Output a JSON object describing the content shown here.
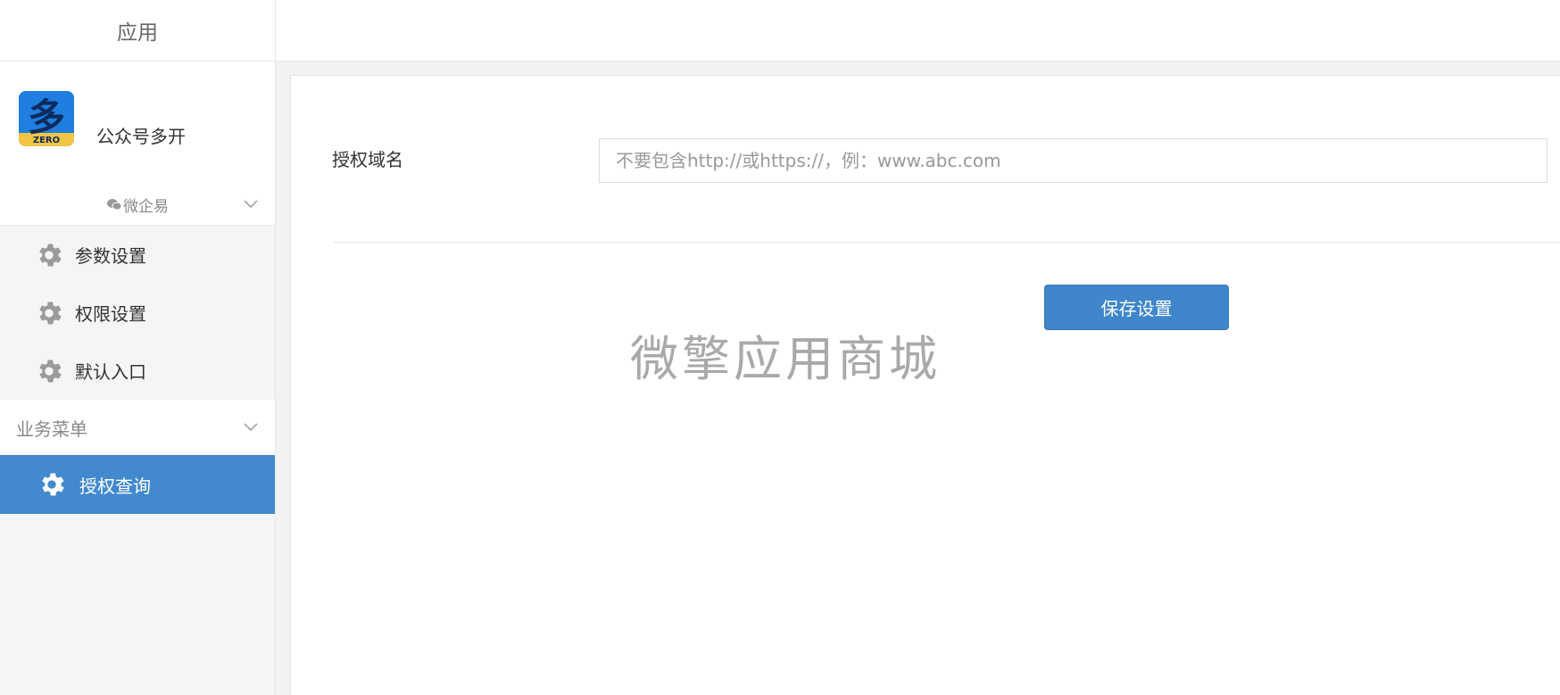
{
  "sidebar": {
    "title": "应用",
    "app": {
      "name": "公众号多开",
      "logo_text": "多",
      "logo_badge": "ZERO"
    },
    "account_group": {
      "label": "微企易"
    },
    "settings_items": [
      {
        "label": "参数设置"
      },
      {
        "label": "权限设置"
      },
      {
        "label": "默认入口"
      }
    ],
    "business_menu": {
      "label": "业务菜单",
      "items": [
        {
          "label": "授权查询",
          "active": true
        }
      ]
    }
  },
  "form": {
    "domain_label": "授权域名",
    "domain_value": "",
    "domain_placeholder": "不要包含http://或https://，例：www.abc.com",
    "save_label": "保存设置"
  },
  "watermark": "微擎应用商城",
  "colors": {
    "accent": "#4289ce",
    "button": "#3f86cb",
    "sidebar_bg": "#f4f5f5"
  }
}
